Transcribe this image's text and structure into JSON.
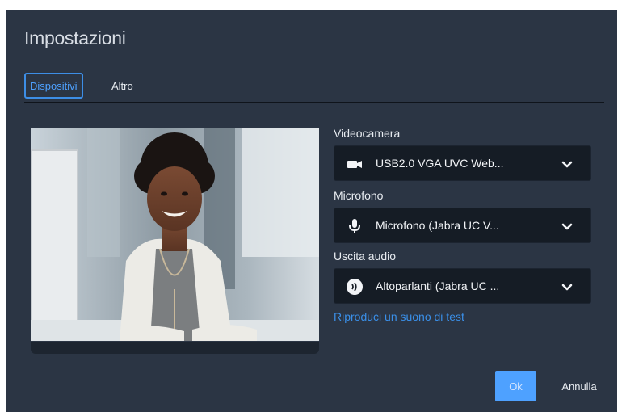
{
  "dialog": {
    "title": "Impostazioni",
    "tabs": [
      {
        "label": "Dispositivi",
        "active": true
      },
      {
        "label": "Altro",
        "active": false
      }
    ]
  },
  "devices": {
    "camera": {
      "label": "Videocamera",
      "value": "USB2.0 VGA UVC Web...",
      "icon": "video-camera-icon"
    },
    "microphone": {
      "label": "Microfono",
      "value": "Microfono (Jabra UC V...",
      "icon": "microphone-icon"
    },
    "speaker": {
      "label": "Uscita audio",
      "value": "Altoparlanti (Jabra UC ...",
      "icon": "speaker-icon"
    },
    "test_sound_link": "Riproduci un suono di test"
  },
  "footer": {
    "ok_label": "Ok",
    "cancel_label": "Annulla"
  },
  "colors": {
    "dialog_bg": "#2b3544",
    "select_bg": "#151c25",
    "accent": "#4ea1ff",
    "link": "#3a8fe8"
  }
}
